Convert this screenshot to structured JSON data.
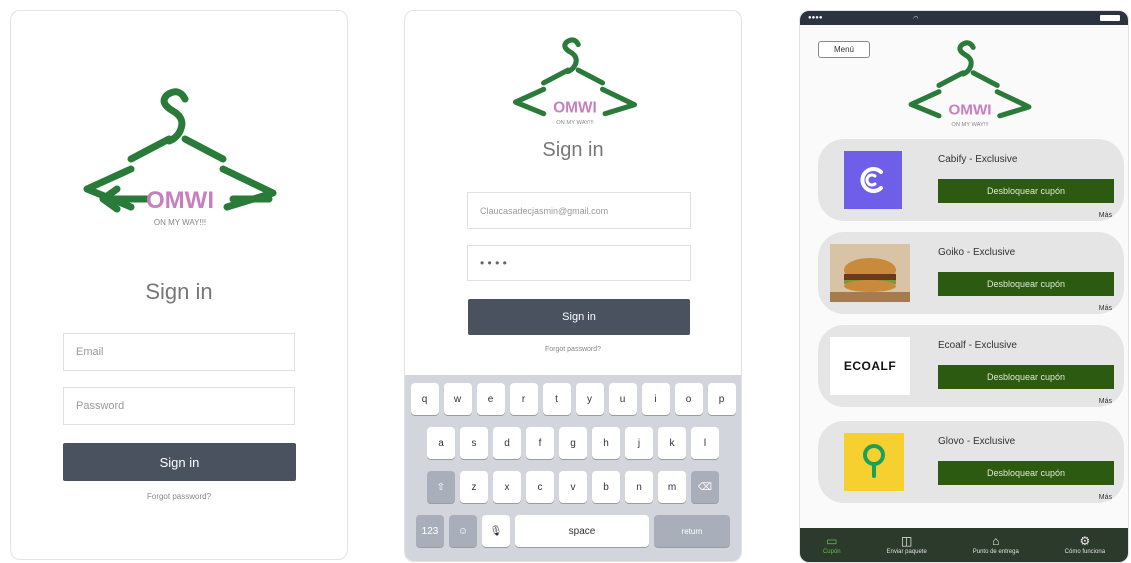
{
  "brand": {
    "name": "OMWI",
    "tagline": "ON MY WAY!!!",
    "accent": "#2a7a3a",
    "name_color": "#c77fc0"
  },
  "login_a": {
    "title": "Sign in",
    "email_placeholder": "Email",
    "password_placeholder": "Password",
    "signin_label": "Sign in",
    "forgot_label": "Forgot password?"
  },
  "login_b": {
    "title": "Sign in",
    "email_value": "Claucasadecjasmin@gmail.com",
    "password_value": "• • • •",
    "signin_label": "Sign in",
    "forgot_label": "Forgot password?",
    "keyboard": {
      "row1": [
        "q",
        "w",
        "e",
        "r",
        "t",
        "y",
        "u",
        "i",
        "o",
        "p"
      ],
      "row2": [
        "a",
        "s",
        "d",
        "f",
        "g",
        "h",
        "j",
        "k",
        "l"
      ],
      "row3": [
        "z",
        "x",
        "c",
        "v",
        "b",
        "n",
        "m"
      ],
      "space_label": "space",
      "return_label": "return"
    }
  },
  "coupons": {
    "menu_label": "Menú",
    "cards": [
      {
        "title": "Cabify - Exclusive",
        "button": "Desbloquear cupón",
        "more": "Más",
        "logo": "cabify-logo"
      },
      {
        "title": "Goiko - Exclusive",
        "button": "Desbloquear cupón",
        "more": "Más",
        "logo": "burger-photo"
      },
      {
        "title": "Ecoalf - Exclusive",
        "button": "Desbloquear cupón",
        "more": "Más",
        "logo_text": "ECOALF"
      },
      {
        "title": "Glovo - Exclusive",
        "button": "Desbloquear cupón",
        "more": "Más",
        "logo": "glovo-logo"
      }
    ],
    "tabs": [
      {
        "label": "Cupón",
        "icon": "coupon-icon"
      },
      {
        "label": "Enviar paquete",
        "icon": "package-icon"
      },
      {
        "label": "Punto de entrega",
        "icon": "home-icon"
      },
      {
        "label": "Cómo funciona",
        "icon": "gear-icon"
      }
    ]
  }
}
